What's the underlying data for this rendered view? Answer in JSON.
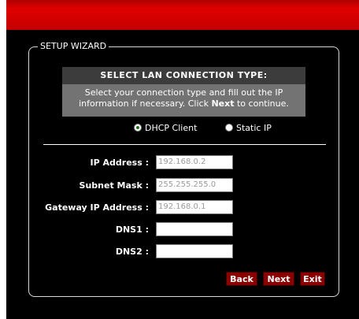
{
  "wizard": {
    "legend": "SETUP WIZARD",
    "instructions": {
      "title": "SELECT LAN CONNECTION TYPE:",
      "line1": "Select your connection type and fill out the IP",
      "line2_prefix": "information if necessary. Click ",
      "line2_bold": "Next",
      "line2_suffix": " to continue."
    },
    "connection_type": {
      "options": [
        "DHCP Client",
        "Static IP"
      ],
      "selected": "DHCP Client"
    },
    "fields": [
      {
        "label": "IP Address :",
        "value": "192.168.0.2"
      },
      {
        "label": "Subnet Mask :",
        "value": "255.255.255.0"
      },
      {
        "label": "Gateway IP Address :",
        "value": "192.168.0.1"
      },
      {
        "label": "DNS1 :",
        "value": ""
      },
      {
        "label": "DNS2 :",
        "value": ""
      }
    ],
    "buttons": {
      "back": "Back",
      "next": "Next",
      "exit": "Exit"
    }
  },
  "colors": {
    "header_red": "#d00000",
    "panel_bg": "#000000",
    "button_bg": "#8a0000"
  }
}
